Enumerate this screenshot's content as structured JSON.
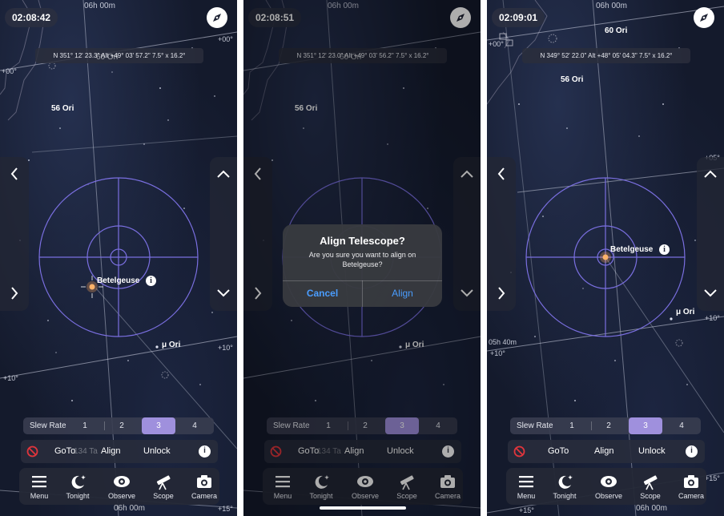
{
  "panels": [
    {
      "time": "02:08:42",
      "coords": "N 351° 12' 23.3\" Alt +49° 03' 57.2\"   7.5° x 16.2°",
      "star_labels": {
        "s56ori": "56 Ori",
        "s60ori": "60 Ori",
        "muori": "μ Ori",
        "target": "Betelgeuse"
      },
      "grid_labels": {
        "top_hour": "06h 00m",
        "bottom_hour": "06h 00m",
        "dec_plus00": "+00°",
        "dec_plus00_left": "+00°",
        "dec_plus10_right": "+10°",
        "dec_plus10_left": "+10°",
        "dec_plus15": "+15°"
      }
    },
    {
      "time": "02:08:51",
      "coords": "N 351° 12' 23.0\" Alt +49° 03' 56.2\"   7.5° x 16.2°",
      "star_labels": {
        "s56ori": "56 Ori",
        "s60ori": "60 Ori",
        "muori": "μ Ori"
      },
      "grid_labels": {
        "top_hour": "06h 00m",
        "bottom_hour": "06h 00m"
      },
      "alert": {
        "title": "Align Telescope?",
        "message": "Are you sure you want to align on Betelgeuse?",
        "cancel": "Cancel",
        "confirm": "Align"
      }
    },
    {
      "time": "02:09:01",
      "coords": "N 349° 52' 22.0\" Alt +48° 05' 04.3\"   7.5° x 16.2°",
      "star_labels": {
        "s56ori": "56 Ori",
        "s60ori": "60 Ori",
        "muori": "μ Ori",
        "target": "Betelgeuse"
      },
      "grid_labels": {
        "top_hour": "06h 00m",
        "bottom_hour": "06h 00m",
        "ra_540": "05h 40m",
        "dec_plus00": "+00°",
        "dec_plus10_left": "+10°",
        "dec_plus10_right": "+10°",
        "dec_plus15_left": "+15°",
        "dec_plus15_right": "+15°",
        "dec_plus05": "+05°"
      }
    }
  ],
  "controls": {
    "slew_rate_label": "Slew Rate",
    "slew_rates": [
      "1",
      "2",
      "3",
      "4"
    ],
    "slew_selected": "3",
    "goto": "GoTo",
    "goto_overlay": "134 Ta",
    "align": "Align",
    "unlock": "Unlock",
    "more": "i"
  },
  "tabs": [
    {
      "label": "Menu",
      "icon": "menu-icon"
    },
    {
      "label": "Tonight",
      "icon": "moon-icon"
    },
    {
      "label": "Observe",
      "icon": "eye-icon"
    },
    {
      "label": "Scope",
      "icon": "telescope-icon"
    },
    {
      "label": "Camera",
      "icon": "camera-icon"
    }
  ],
  "colors": {
    "crosshair": "#7a6fe0",
    "selected_slew": "#9f90dd",
    "alert_button": "#4a9dff",
    "stop": "#e0353c"
  }
}
